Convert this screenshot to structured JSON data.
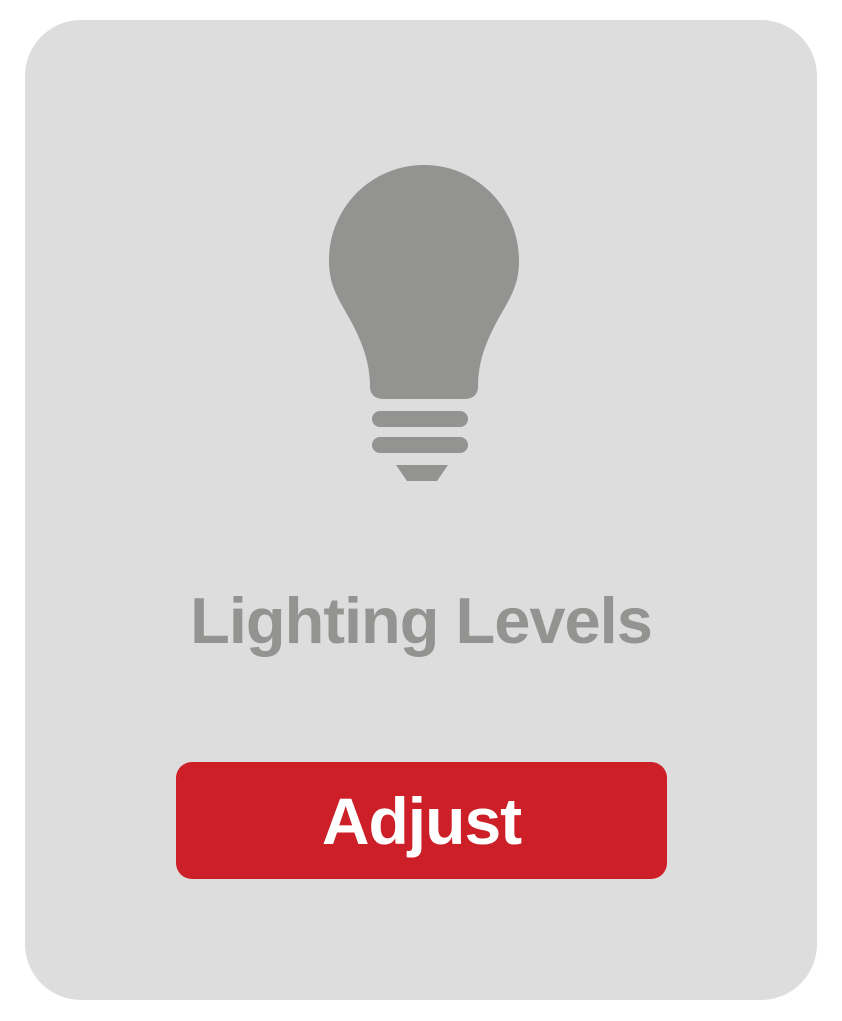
{
  "card": {
    "background_color": "#dddddd",
    "icon": "lightbulb-icon",
    "icon_color": "#939391",
    "title": "Lighting Levels",
    "title_color": "#939391",
    "button": {
      "label": "Adjust",
      "background_color": "#cd1f27",
      "text_color": "#ffffff"
    }
  }
}
